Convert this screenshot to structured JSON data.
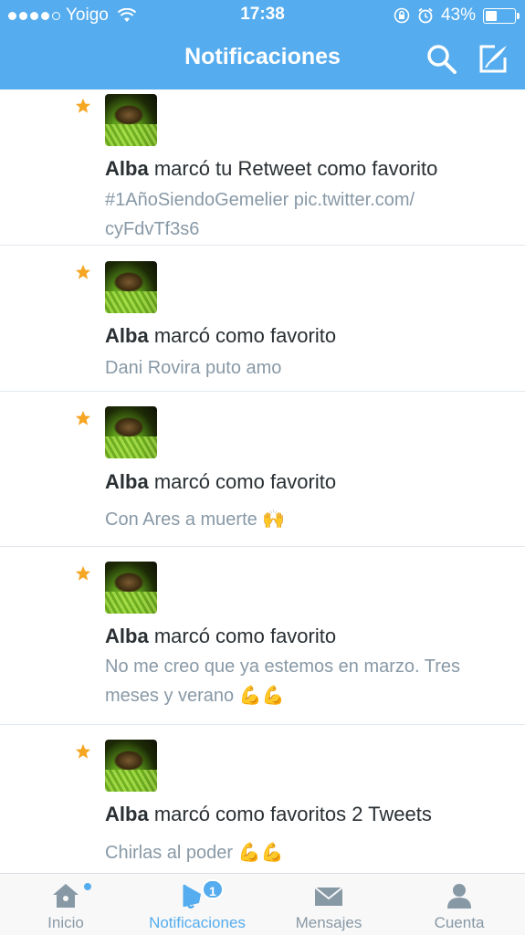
{
  "status_bar": {
    "carrier": "Yoigo",
    "time": "17:38",
    "battery": "43%",
    "battery_level": 0.43,
    "signal_bars": 4
  },
  "header": {
    "title": "Notificaciones",
    "search_icon": "search-icon",
    "compose_icon": "compose-icon",
    "color": "#55acee"
  },
  "notifications": [
    {
      "user": "Alba",
      "action": "marcó tu Retweet como favorito",
      "tweet": "#1AñoSiendoGemelier pic.twitter.com/ cyFdvTf3s6"
    },
    {
      "user": "Alba",
      "action": "marcó como favorito",
      "tweet": "Dani Rovira puto amo"
    },
    {
      "user": "Alba",
      "action": "marcó como favorito",
      "tweet": "Con Ares a muerte",
      "emoji": "🙌"
    },
    {
      "user": "Alba",
      "action": "marcó como favorito",
      "tweet": "No me creo que ya estemos en marzo. Tres meses y verano",
      "emoji": "💪💪"
    },
    {
      "user": "Alba",
      "action": "marcó como favoritos 2 Tweets",
      "tweet": "Chirlas al poder",
      "emoji": "💪💪"
    }
  ],
  "tabbar": {
    "tabs": [
      {
        "label": "Inicio",
        "icon": "home-icon"
      },
      {
        "label": "Notificaciones",
        "icon": "bell-icon",
        "badge": "1"
      },
      {
        "label": "Mensajes",
        "icon": "envelope-icon"
      },
      {
        "label": "Cuenta",
        "icon": "person-icon"
      }
    ]
  }
}
